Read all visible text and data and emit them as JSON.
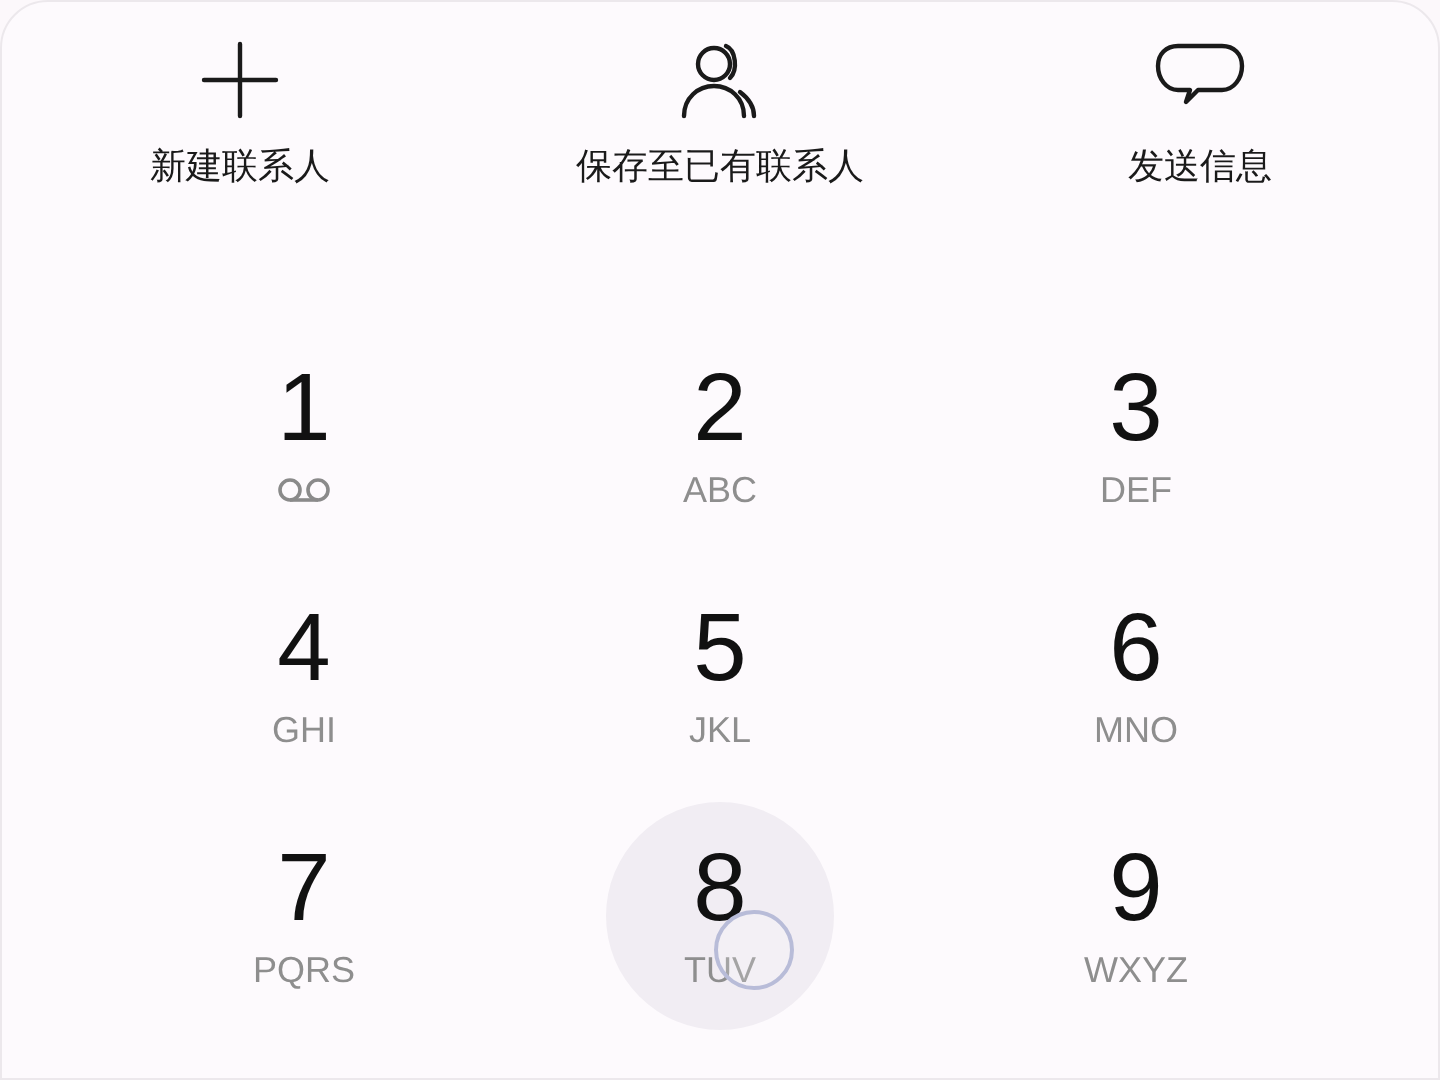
{
  "actions": [
    {
      "kind": "new",
      "label": "新建联系人"
    },
    {
      "kind": "save",
      "label": "保存至已有联系人"
    },
    {
      "kind": "message",
      "label": "发送信息"
    }
  ],
  "keypad": [
    {
      "digit": "1",
      "kind": "voicemail",
      "pressed": false
    },
    {
      "digit": "2",
      "kind": "letters",
      "letters": "ABC",
      "pressed": false
    },
    {
      "digit": "3",
      "kind": "letters",
      "letters": "DEF",
      "pressed": false
    },
    {
      "digit": "4",
      "kind": "letters",
      "letters": "GHI",
      "pressed": false
    },
    {
      "digit": "5",
      "kind": "letters",
      "letters": "JKL",
      "pressed": false
    },
    {
      "digit": "6",
      "kind": "letters",
      "letters": "MNO",
      "pressed": false
    },
    {
      "digit": "7",
      "kind": "letters",
      "letters": "PQRS",
      "pressed": false
    },
    {
      "digit": "8",
      "kind": "letters",
      "letters": "TUV",
      "pressed": true
    },
    {
      "digit": "9",
      "kind": "letters",
      "letters": "WXYZ",
      "pressed": false
    }
  ]
}
